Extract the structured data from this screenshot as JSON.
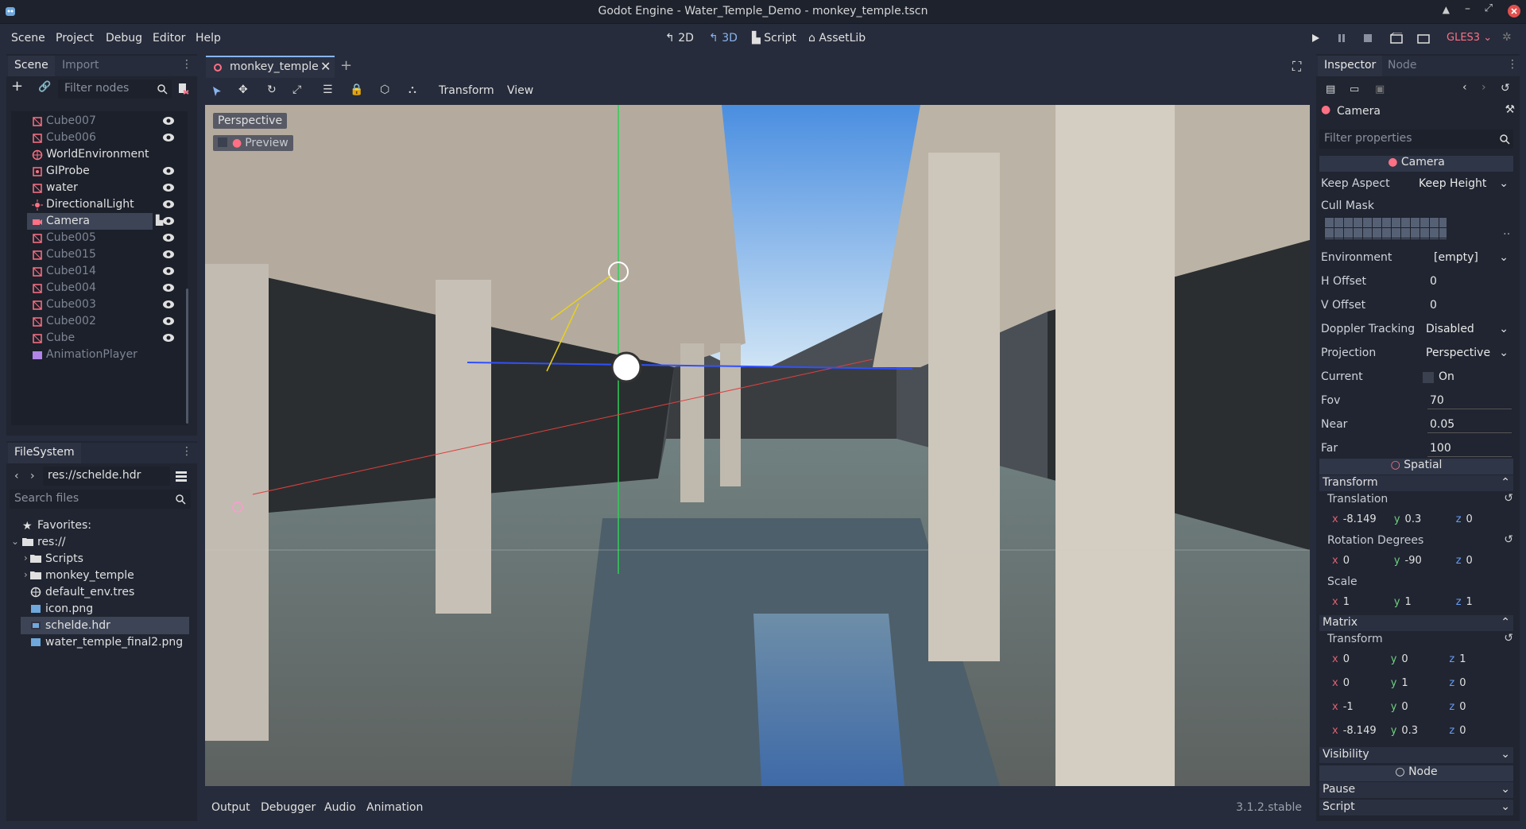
{
  "window": {
    "title": "Godot Engine - Water_Temple_Demo - monkey_temple.tscn"
  },
  "menu": {
    "items": [
      "Scene",
      "Project",
      "Debug",
      "Editor",
      "Help"
    ]
  },
  "modes": {
    "m2d": "2D",
    "m3d": "3D",
    "script": "Script",
    "assetlib": "AssetLib"
  },
  "renderer": "GLES3",
  "scene_dock": {
    "tab_scene": "Scene",
    "tab_import": "Import",
    "filter_placeholder": "Filter nodes",
    "nodes": [
      {
        "name": "Cube007",
        "dim": true,
        "eye": true,
        "icon": "mesh-icon"
      },
      {
        "name": "Cube006",
        "dim": true,
        "eye": true,
        "icon": "mesh-icon"
      },
      {
        "name": "WorldEnvironment",
        "dim": false,
        "eye": false,
        "icon": "world-icon"
      },
      {
        "name": "GIProbe",
        "dim": false,
        "eye": true,
        "icon": "probe-icon"
      },
      {
        "name": "water",
        "dim": false,
        "eye": true,
        "icon": "mesh-icon"
      },
      {
        "name": "DirectionalLight",
        "dim": false,
        "eye": true,
        "icon": "light-icon"
      },
      {
        "name": "Camera",
        "dim": false,
        "eye": true,
        "icon": "camera-icon",
        "selected": true
      },
      {
        "name": "Cube005",
        "dim": true,
        "eye": true,
        "icon": "mesh-icon"
      },
      {
        "name": "Cube015",
        "dim": true,
        "eye": true,
        "icon": "mesh-icon"
      },
      {
        "name": "Cube014",
        "dim": true,
        "eye": true,
        "icon": "mesh-icon"
      },
      {
        "name": "Cube004",
        "dim": true,
        "eye": true,
        "icon": "mesh-icon"
      },
      {
        "name": "Cube003",
        "dim": true,
        "eye": true,
        "icon": "mesh-icon"
      },
      {
        "name": "Cube002",
        "dim": true,
        "eye": true,
        "icon": "mesh-icon"
      },
      {
        "name": "Cube",
        "dim": true,
        "eye": true,
        "icon": "mesh-icon"
      },
      {
        "name": "AnimationPlayer",
        "dim": true,
        "eye": false,
        "icon": "animation-icon"
      }
    ]
  },
  "filesystem": {
    "title": "FileSystem",
    "path": "res://schelde.hdr",
    "search_placeholder": "Search files",
    "items": [
      {
        "name": "Favorites:",
        "icon": "star-icon",
        "indent": 0
      },
      {
        "name": "res://",
        "icon": "folder-icon",
        "indent": 0
      },
      {
        "name": "Scripts",
        "icon": "folder-icon",
        "indent": 1
      },
      {
        "name": "monkey_temple",
        "icon": "folder-icon",
        "indent": 1
      },
      {
        "name": "default_env.tres",
        "icon": "world-icon",
        "indent": 1
      },
      {
        "name": "icon.png",
        "icon": "image-icon",
        "indent": 1
      },
      {
        "name": "schelde.hdr",
        "icon": "hdr-icon",
        "indent": 1,
        "selected": true
      },
      {
        "name": "water_temple_final2.png",
        "icon": "image-icon",
        "indent": 1
      }
    ]
  },
  "editor": {
    "scene_tab": "monkey_temple",
    "toolbar_transform": "Transform",
    "toolbar_view": "View",
    "viewport_perspective": "Perspective",
    "viewport_preview": "Preview"
  },
  "bottom": {
    "tabs": [
      "Output",
      "Debugger",
      "Audio",
      "Animation"
    ],
    "version": "3.1.2.stable"
  },
  "inspector": {
    "tab_inspector": "Inspector",
    "tab_node": "Node",
    "object": "Camera",
    "filter_placeholder": "Filter properties",
    "camera_section": "Camera",
    "keep_aspect_k": "Keep Aspect",
    "keep_aspect_v": "Keep Height",
    "cull_mask_k": "Cull Mask",
    "environment_k": "Environment",
    "environment_v": "[empty]",
    "h_offset_k": "H Offset",
    "h_offset_v": "0",
    "v_offset_k": "V Offset",
    "v_offset_v": "0",
    "doppler_k": "Doppler Tracking",
    "doppler_v": "Disabled",
    "projection_k": "Projection",
    "projection_v": "Perspective",
    "current_k": "Current",
    "current_v": "On",
    "fov_k": "Fov",
    "fov_v": "70",
    "near_k": "Near",
    "near_v": "0.05",
    "far_k": "Far",
    "far_v": "100",
    "spatial_section": "Spatial",
    "transform_group": "Transform",
    "translation_k": "Translation",
    "translation": [
      "-8.149",
      "0.3",
      "0"
    ],
    "rotation_k": "Rotation Degrees",
    "rotation": [
      "0",
      "-90",
      "0"
    ],
    "scale_k": "Scale",
    "scale": [
      "1",
      "1",
      "1"
    ],
    "matrix_group": "Matrix",
    "matrix_transform_k": "Transform",
    "matrix": [
      [
        "0",
        "0",
        "1"
      ],
      [
        "0",
        "1",
        "0"
      ],
      [
        "-1",
        "0",
        "0"
      ],
      [
        "-8.149",
        "0.3",
        "0"
      ]
    ],
    "visibility_group": "Visibility",
    "node_section": "Node",
    "pause_group": "Pause",
    "script_group": "Script"
  },
  "colors": {
    "accent": "#8ab4f0",
    "selected": "#3d4456",
    "red_icon": "#ff7085"
  }
}
